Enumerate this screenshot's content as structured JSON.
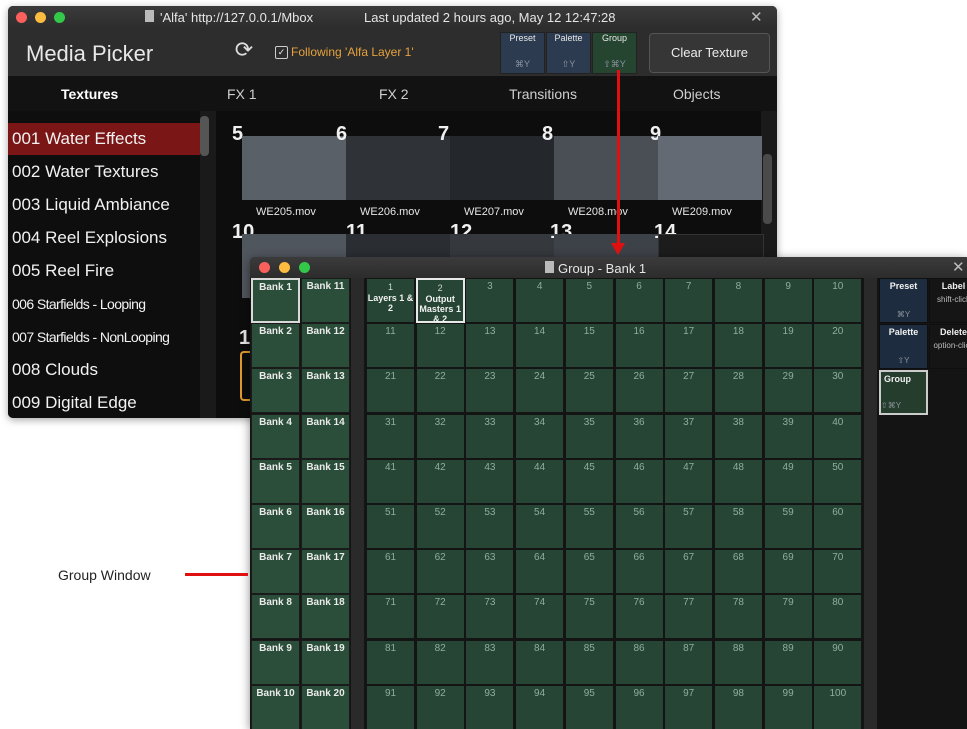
{
  "media_picker": {
    "window_title": "'Alfa' http://127.0.0.1/Mbox",
    "last_updated": "Last updated 2 hours ago, May 12 12:47:28",
    "title": "Media Picker",
    "following_label": "Following 'Alfa Layer 1'",
    "mode_buttons": [
      {
        "label": "Preset",
        "key": "⌘Y"
      },
      {
        "label": "Palette",
        "key": "⇧Y"
      },
      {
        "label": "Group",
        "key": "⇧⌘Y"
      }
    ],
    "clear_texture_label": "Clear Texture",
    "tabs": [
      "Textures",
      "FX 1",
      "FX 2",
      "Transitions",
      "Objects"
    ],
    "folders": [
      "001 Water Effects",
      "002 Water Textures",
      "003 Liquid Ambiance",
      "004 Reel Explosions",
      "005 Reel Fire",
      "006 Starfields - Looping",
      "007 Starfields - NonLooping",
      "008 Clouds",
      "009 Digital Edge"
    ],
    "cells": [
      {
        "num": "5",
        "name": "WE205.mov"
      },
      {
        "num": "6",
        "name": "WE206.mov"
      },
      {
        "num": "7",
        "name": "WE207.mov"
      },
      {
        "num": "8",
        "name": "WE208.mov"
      },
      {
        "num": "9",
        "name": "WE209.mov"
      },
      {
        "num": "10",
        "name": ""
      },
      {
        "num": "11",
        "name": ""
      },
      {
        "num": "12",
        "name": ""
      },
      {
        "num": "13",
        "name": ""
      },
      {
        "num": "14",
        "name": ""
      }
    ],
    "partial_cell_num": "1"
  },
  "group_window": {
    "title": "Group - Bank 1",
    "banks_left": [
      "Bank 1",
      "Bank 2",
      "Bank 3",
      "Bank 4",
      "Bank 5",
      "Bank 6",
      "Bank 7",
      "Bank 8",
      "Bank 9",
      "Bank 10"
    ],
    "banks_right": [
      "Bank 11",
      "Bank 12",
      "Bank 13",
      "Bank 14",
      "Bank 15",
      "Bank 16",
      "Bank 17",
      "Bank 18",
      "Bank 19",
      "Bank 20"
    ],
    "groups": [
      {
        "num": "1",
        "label": "Layers 1 & 2"
      },
      {
        "num": "2",
        "label": "Output Masters 1 & 2"
      }
    ],
    "side_buttons": {
      "preset": {
        "label": "Preset",
        "key": "⌘Y"
      },
      "palette": {
        "label": "Palette",
        "key": "⇧Y"
      },
      "group": {
        "label": "Group",
        "key": "⇧⌘Y"
      },
      "label": {
        "label": "Label",
        "sub": "shift-click"
      },
      "delete": {
        "label": "Delete",
        "sub": "option-click"
      }
    }
  },
  "callout": {
    "label": "Group Window"
  },
  "colors": {
    "selected_folder": "#7a1616",
    "group_cell": "#264535",
    "arrow": "#e01010",
    "following": "#e6a23c"
  }
}
